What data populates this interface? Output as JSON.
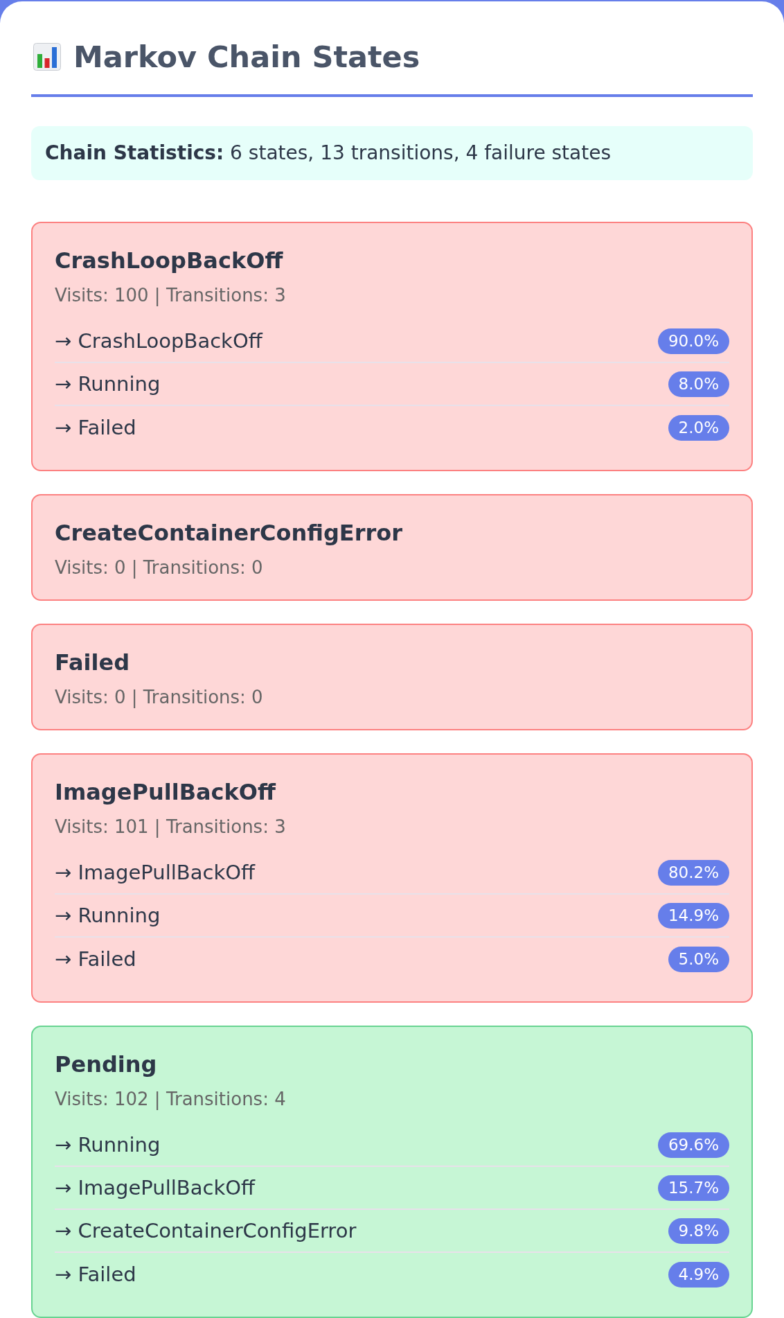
{
  "header": {
    "title": "Markov Chain States"
  },
  "stats": {
    "text": "**Chain Statistics:** 6 states, 13 transitions, 4 failure states"
  },
  "states": [
    {
      "name": "CrashLoopBackOff",
      "failure": true,
      "meta": "Visits: 100 | Transitions: 3",
      "transitions": [
        {
          "target": "→ CrashLoopBackOff",
          "probability": "90.0%"
        },
        {
          "target": "→ Running",
          "probability": "8.0%"
        },
        {
          "target": "→ Failed",
          "probability": "2.0%"
        }
      ]
    },
    {
      "name": "CreateContainerConfigError",
      "failure": true,
      "meta": "Visits: 0 | Transitions: 0"
    },
    {
      "name": "Failed",
      "failure": true,
      "meta": "Visits: 0 | Transitions: 0"
    },
    {
      "name": "ImagePullBackOff",
      "failure": true,
      "meta": "Visits: 101 | Transitions: 3",
      "transitions": [
        {
          "target": "→ ImagePullBackOff",
          "probability": "80.2%"
        },
        {
          "target": "→ Running",
          "probability": "14.9%"
        },
        {
          "target": "→ Failed",
          "probability": "5.0%"
        }
      ]
    },
    {
      "name": "Pending",
      "failure": false,
      "meta": "Visits: 102 | Transitions: 4",
      "transitions": [
        {
          "target": "→ Running",
          "probability": "69.6%"
        },
        {
          "target": "→ ImagePullBackOff",
          "probability": "15.7%"
        },
        {
          "target": "→ CreateContainerConfigError",
          "probability": "9.8%"
        },
        {
          "target": "→ Failed",
          "probability": "4.9%"
        }
      ]
    }
  ]
}
